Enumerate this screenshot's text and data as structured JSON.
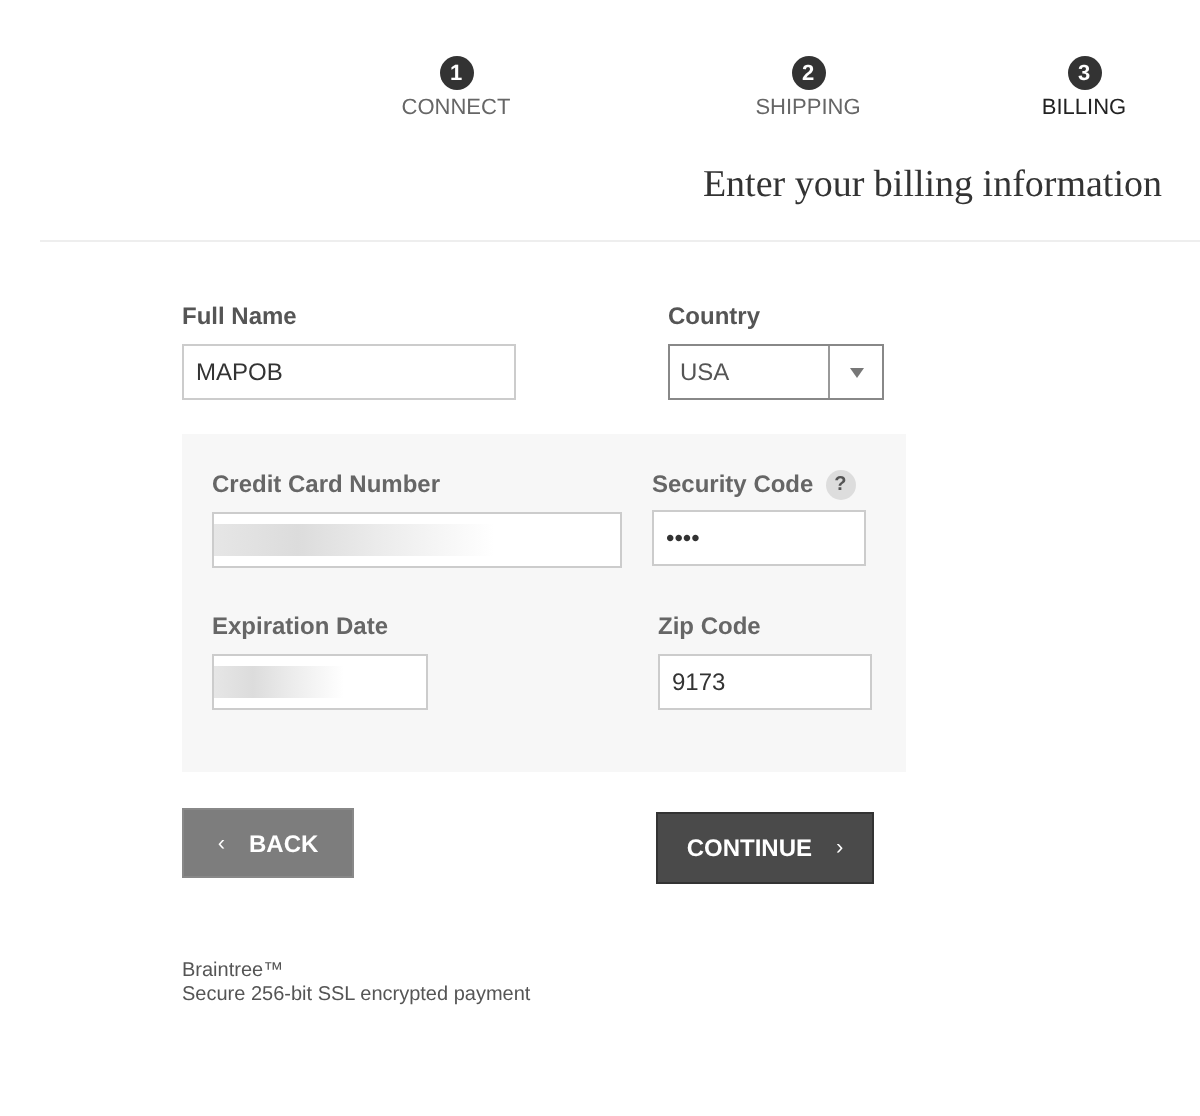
{
  "steps": [
    {
      "number": "1",
      "label": "CONNECT",
      "selected": false
    },
    {
      "number": "2",
      "label": "SHIPPING",
      "selected": false
    },
    {
      "number": "3",
      "label": "BILLING",
      "selected": true
    }
  ],
  "heading": "Enter your billing information",
  "full_name": {
    "label": "Full Name",
    "value": "MAPOB"
  },
  "country": {
    "label": "Country",
    "value": "USA"
  },
  "card": {
    "number": {
      "label": "Credit Card Number",
      "redacted": true
    },
    "security_code": {
      "label": "Security Code",
      "help": "?",
      "value": "••••"
    },
    "expiration": {
      "label": "Expiration Date",
      "redacted": true
    },
    "zip": {
      "label": "Zip Code",
      "value": "9173"
    }
  },
  "buttons": {
    "back": {
      "label": "BACK",
      "icon": "‹"
    },
    "continue": {
      "label": "CONTINUE",
      "icon": "›"
    }
  },
  "footer": [
    "Braintree™",
    "Secure 256-bit SSL encrypted payment"
  ]
}
